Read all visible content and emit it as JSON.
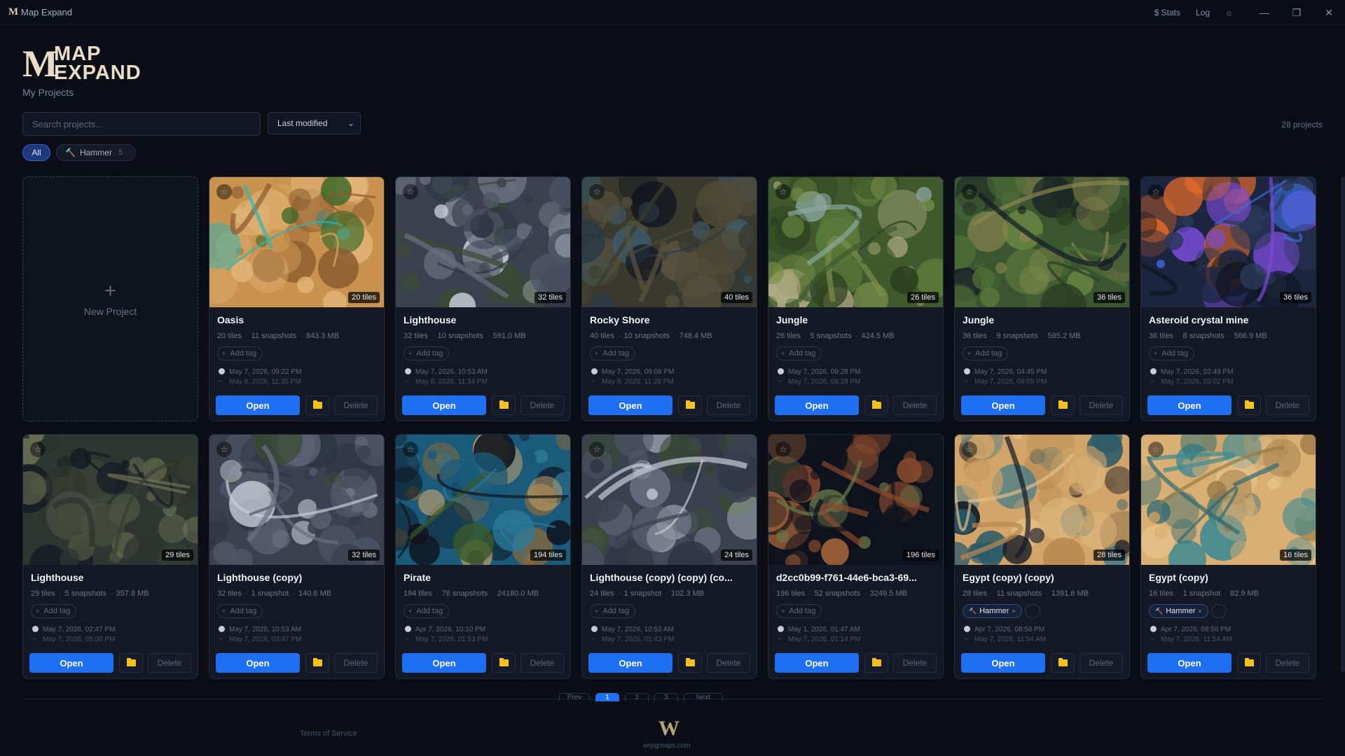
{
  "window": {
    "app_title": "Map Expand",
    "stats": "$ Stats",
    "log": "Log",
    "minimize": "—",
    "maximize": "❐",
    "close": "✕",
    "theme": "☼"
  },
  "header": {
    "logo_top": "MAP",
    "logo_bottom": "EXPAND",
    "logo_letter": "M",
    "subtitle": "My Projects"
  },
  "toolbar": {
    "search_placeholder": "Search projects...",
    "sort_value": "Last modified",
    "project_count": "28 projects"
  },
  "filters": {
    "all_label": "All",
    "tag_label": "Hammer",
    "tag_count": "5"
  },
  "new_project": {
    "label": "New Project",
    "plus": "+"
  },
  "labels": {
    "open": "Open",
    "delete": "Delete",
    "add_tag": "Add tag",
    "star": "☆",
    "tag_close": "×"
  },
  "projects": [
    {
      "title": "Oasis",
      "tiles": "20 tiles",
      "snapshots": "11 snapshots",
      "size": "843.3 MB",
      "created": "May 7, 2026, 09:22 PM",
      "modified": "May 8, 2026, 11:35 PM",
      "tag": "",
      "palette": "desert"
    },
    {
      "title": "Lighthouse",
      "tiles": "32 tiles",
      "snapshots": "10 snapshots",
      "size": "591.0 MB",
      "created": "May 7, 2026, 10:53 AM",
      "modified": "May 8, 2026, 11:34 PM",
      "tag": "",
      "palette": "rock"
    },
    {
      "title": "Rocky Shore",
      "tiles": "40 tiles",
      "snapshots": "10 snapshots",
      "size": "748.4 MB",
      "created": "May 7, 2026, 09:08 PM",
      "modified": "May 8, 2026, 11:28 PM",
      "tag": "",
      "palette": "shore"
    },
    {
      "title": "Jungle",
      "tiles": "26 tiles",
      "snapshots": "5 snapshots",
      "size": "424.5 MB",
      "created": "May 7, 2026, 09:28 PM",
      "modified": "May 7, 2026, 09:39 PM",
      "tag": "",
      "palette": "jungle"
    },
    {
      "title": "Jungle",
      "tiles": "36 tiles",
      "snapshots": "9 snapshots",
      "size": "595.2 MB",
      "created": "May 7, 2026, 04:45 PM",
      "modified": "May 7, 2026, 09:05 PM",
      "tag": "",
      "palette": "jungle2"
    },
    {
      "title": "Asteroid crystal mine",
      "tiles": "36 tiles",
      "snapshots": "8 snapshots",
      "size": "566.9 MB",
      "created": "May 7, 2026, 02:49 PM",
      "modified": "May 7, 2026, 03:02 PM",
      "tag": "",
      "palette": "asteroid"
    },
    {
      "title": "Lighthouse",
      "tiles": "29 tiles",
      "snapshots": "5 snapshots",
      "size": "357.8 MB",
      "created": "May 7, 2026, 02:47 PM",
      "modified": "May 7, 2026, 05:00 PM",
      "tag": "",
      "palette": "rock2"
    },
    {
      "title": "Lighthouse (copy)",
      "tiles": "32 tiles",
      "snapshots": "1 snapshot",
      "size": "140.6 MB",
      "created": "May 7, 2026, 10:53 AM",
      "modified": "May 7, 2026, 03:47 PM",
      "tag": "",
      "palette": "rock"
    },
    {
      "title": "Pirate",
      "tiles": "194 tiles",
      "snapshots": "76 snapshots",
      "size": "24180.0 MB",
      "created": "Apr 7, 2026, 10:10 PM",
      "modified": "May 7, 2026, 01:53 PM",
      "tag": "",
      "palette": "pirate"
    },
    {
      "title": "Lighthouse (copy) (copy) (co...",
      "tiles": "24 tiles",
      "snapshots": "1 snapshot",
      "size": "102.3 MB",
      "created": "May 7, 2026, 10:53 AM",
      "modified": "May 7, 2026, 01:43 PM",
      "tag": "",
      "palette": "rock"
    },
    {
      "title": "d2cc0b99-f761-44e6-bca3-69...",
      "tiles": "196 tiles",
      "snapshots": "52 snapshots",
      "size": "3249.5 MB",
      "created": "May 1, 2026, 01:47 AM",
      "modified": "May 7, 2026, 01:14 PM",
      "tag": "",
      "palette": "scatter"
    },
    {
      "title": "Egypt (copy) (copy)",
      "tiles": "28 tiles",
      "snapshots": "11 snapshots",
      "size": "1391.6 MB",
      "created": "Apr 7, 2026, 08:58 PM",
      "modified": "May 7, 2026, 11:54 AM",
      "tag": "Hammer",
      "palette": "egypt"
    },
    {
      "title": "Egypt (copy)",
      "tiles": "16 tiles",
      "snapshots": "1 snapshot",
      "size": "82.9 MB",
      "created": "Apr 7, 2026, 08:58 PM",
      "modified": "May 7, 2026, 11:54 AM",
      "tag": "Hammer",
      "palette": "egypt2"
    }
  ],
  "pagination": {
    "prev": "Prev",
    "pages": [
      "1",
      "2",
      "3"
    ],
    "next": "Next",
    "current": "1"
  },
  "footer": {
    "terms": "Terms of Service",
    "logo": "W",
    "url": "wrpgmaps.com"
  },
  "colors": {
    "accent": "#1f6ff2",
    "background": "#0b0e16",
    "card": "#141925",
    "folder": "#f4c21f"
  }
}
